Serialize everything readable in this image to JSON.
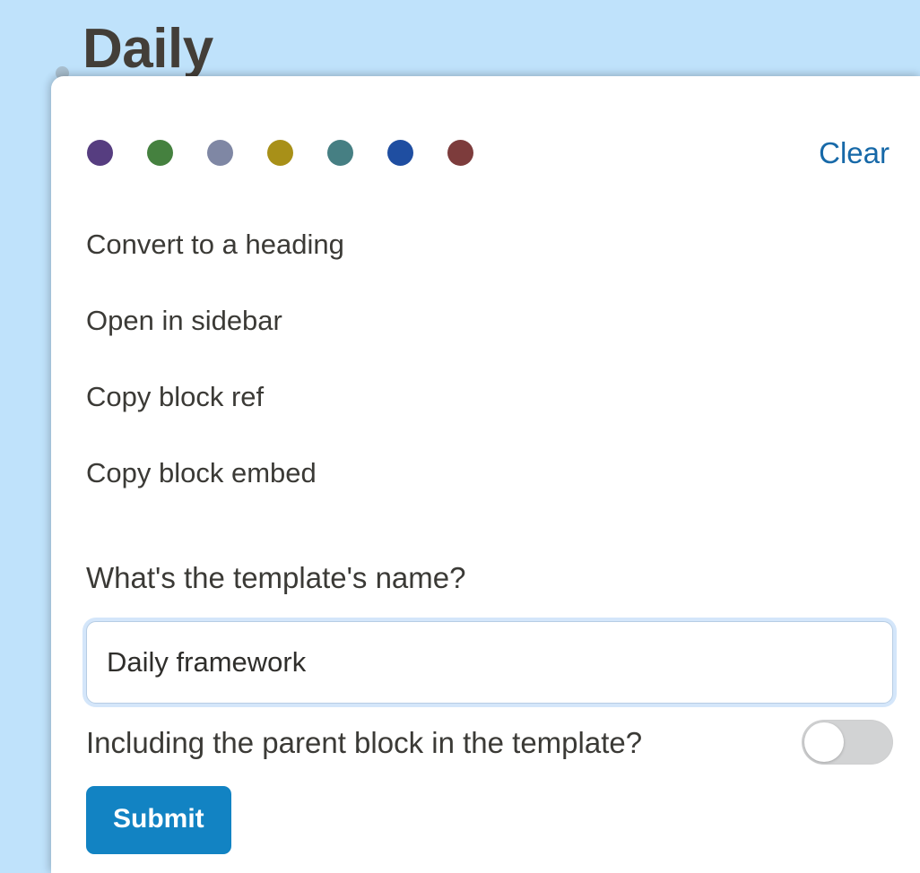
{
  "background": {
    "bullet_icon": "bullet-dot-icon",
    "page_title": "Daily",
    "background_color": "#bfe2fb",
    "title_color": "#433e38"
  },
  "popup": {
    "swatches": [
      {
        "name": "purple",
        "color": "#563d80"
      },
      {
        "name": "green",
        "color": "#45813f"
      },
      {
        "name": "slate-blue",
        "color": "#7f87a4"
      },
      {
        "name": "olive",
        "color": "#a89018"
      },
      {
        "name": "teal",
        "color": "#467f83"
      },
      {
        "name": "blue",
        "color": "#1f4ea1"
      },
      {
        "name": "maroon",
        "color": "#7d3c3c"
      }
    ],
    "clear_label": "Clear",
    "clear_color": "#1769a8",
    "menu_items": [
      {
        "label": "Convert to a heading"
      },
      {
        "label": "Open in sidebar"
      },
      {
        "label": "Copy block ref"
      },
      {
        "label": "Copy block embed"
      }
    ],
    "form": {
      "template_name_label": "What's the template's name?",
      "template_name_value": "Daily framework",
      "template_name_placeholder": "",
      "parent_block_label": "Including the parent block in the template?",
      "parent_block_toggle_state": "off",
      "submit_label": "Submit",
      "submit_color": "#1283c3"
    }
  }
}
